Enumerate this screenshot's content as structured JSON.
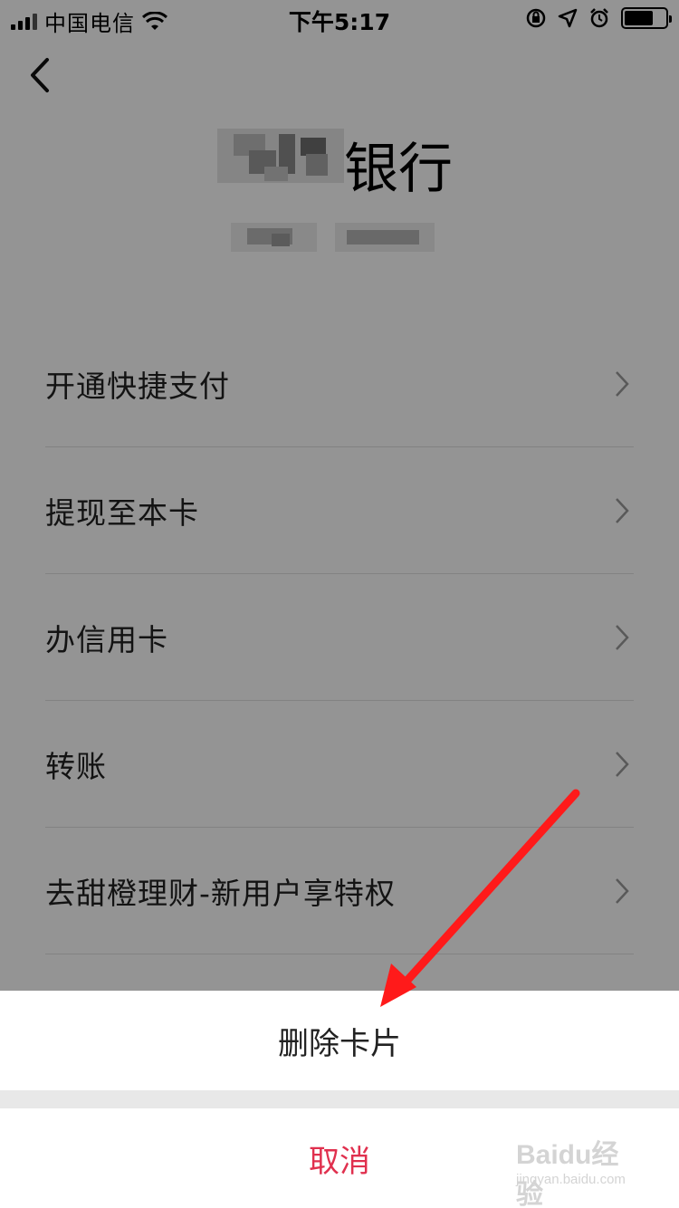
{
  "status_bar": {
    "carrier": "中国电信",
    "time": "下午5:17",
    "icons": [
      "signal-icon",
      "wifi-icon",
      "rotation-lock-icon",
      "location-icon",
      "alarm-icon",
      "battery-icon"
    ]
  },
  "header": {
    "back_icon": "chevron-left-icon",
    "bank_name_suffix": "银行"
  },
  "menu": {
    "items": [
      {
        "label": "开通快捷支付"
      },
      {
        "label": "提现至本卡"
      },
      {
        "label": "办信用卡"
      },
      {
        "label": "转账"
      },
      {
        "label": "去甜橙理财-新用户享特权"
      }
    ]
  },
  "action_sheet": {
    "delete_label": "删除卡片",
    "cancel_label": "取消",
    "cancel_color": "#e0304e"
  },
  "annotation": {
    "arrow_color": "#ff1a1a"
  },
  "watermark": {
    "brand": "Baidu经验",
    "url": "jingyan.baidu.com"
  }
}
